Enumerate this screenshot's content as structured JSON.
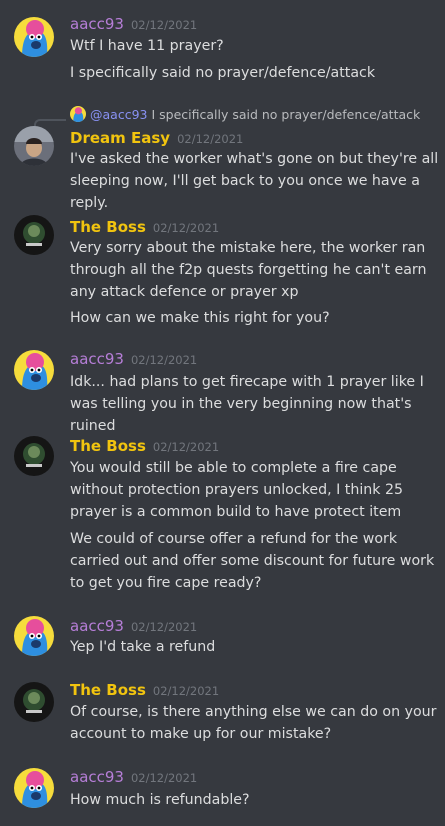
{
  "users": {
    "aacc93": {
      "name": "aacc93",
      "color": "#b67ed7",
      "avatar_icon": "bird-avatar-icon"
    },
    "dream_easy": {
      "name": "Dream Easy",
      "color": "#f1c40f",
      "avatar_icon": "photo-avatar-icon"
    },
    "the_boss": {
      "name": "The Boss",
      "color": "#f1c40f",
      "avatar_icon": "boss-logo-avatar-icon"
    }
  },
  "messages": [
    {
      "author": "aacc93",
      "timestamp": "02/12/2021",
      "lines": [
        "Wtf I have 11 prayer?",
        "I specifically said no prayer/defence/attack"
      ]
    },
    {
      "author": "Dream Easy",
      "timestamp": "02/12/2021",
      "reply": {
        "mention": "@aacc93",
        "text": "I specifically said no prayer/defence/attack"
      },
      "lines": [
        "I've asked the worker what's gone on but they're all sleeping now, I'll get back to you once we have a reply."
      ]
    },
    {
      "author": "The Boss",
      "timestamp": "02/12/2021",
      "lines": [
        "Very sorry about the mistake here, the worker ran through all the f2p quests forgetting he can't earn any attack defence or prayer xp",
        "How can we make this right for you?"
      ]
    },
    {
      "author": "aacc93",
      "timestamp": "02/12/2021",
      "lines": [
        "Idk... had plans to get firecape with 1 prayer like I was telling you in the very beginning now that's ruined"
      ]
    },
    {
      "author": "The Boss",
      "timestamp": "02/12/2021",
      "lines": [
        "You would still be able to complete a fire cape without protection prayers unlocked, I think 25 prayer is a common build to have protect item",
        "We could of course offer a refund for the work carried out and offer some discount for future work to get you fire cape ready?"
      ]
    },
    {
      "author": "aacc93",
      "timestamp": "02/12/2021",
      "lines": [
        "Yep I'd take a refund"
      ]
    },
    {
      "author": "The Boss",
      "timestamp": "02/12/2021",
      "lines": [
        "Of course, is there anything else we can do on your account to make up for our mistake?"
      ]
    },
    {
      "author": "aacc93",
      "timestamp": "02/12/2021",
      "lines": [
        "How much is refundable?"
      ]
    }
  ]
}
